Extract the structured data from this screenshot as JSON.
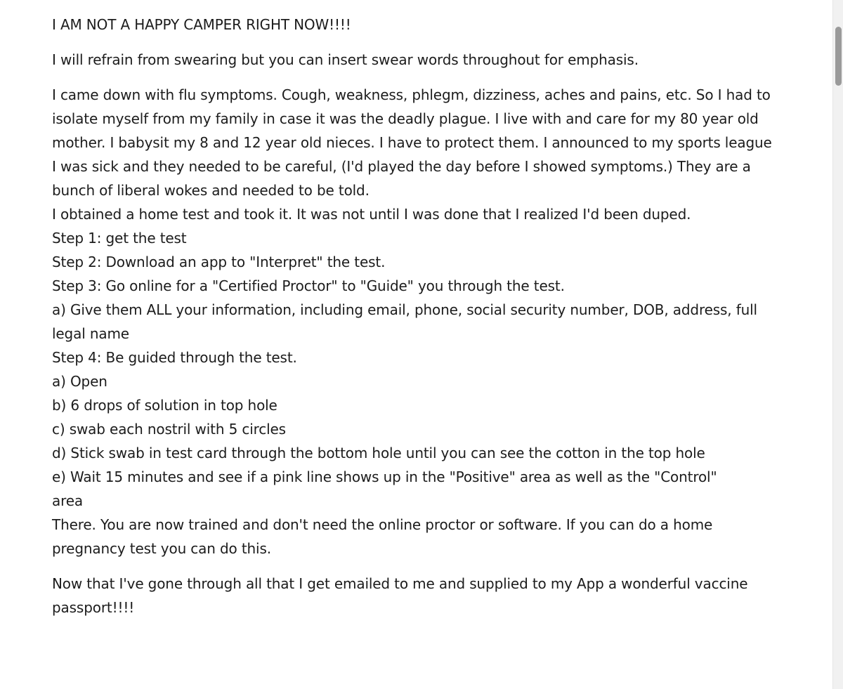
{
  "post": {
    "heading": "I AM NOT A HAPPY CAMPER RIGHT NOW!!!!",
    "para1": "I will refrain from swearing but you can insert swear words throughout for emphasis.",
    "para2_lines": [
      "I came down with flu symptoms. Cough, weakness, phlegm, dizziness, aches and pains, etc. So I had to",
      "isolate myself from my family in case it was the deadly plague. I live with and care for my 80 year old",
      "mother. I babysit my 8 and 12 year old nieces. I have to protect them. I announced to my sports league",
      "I was sick and they needed to be careful, (I'd played the day before I showed symptoms.) They are a",
      "bunch of liberal wokes and needed to be told.",
      "I obtained a home test and took it. It was not until I was done that I realized I'd been duped.",
      "Step 1: get the test",
      "Step 2: Download an app to \"Interpret\" the test.",
      "Step 3: Go online for a \"Certified Proctor\" to \"Guide\" you through the test.",
      "a) Give them ALL your information, including email, phone, social security number, DOB, address, full",
      "legal name",
      "Step 4: Be guided through the test.",
      "a) Open",
      "b) 6 drops of solution in top hole",
      "c) swab each nostril with 5 circles",
      "d) Stick swab in test card through the bottom hole until you can see the cotton in the top hole",
      "e) Wait 15 minutes and see if a pink line shows up in the \"Positive\" area as well as the \"Control\"",
      "area",
      "There. You are now trained and don't need the online proctor or software. If you can do a home",
      "pregnancy test you can do this."
    ],
    "para3_lines": [
      "Now that I've gone through all that I get emailed to me and supplied to my App a wonderful vaccine",
      "passport!!!!"
    ]
  }
}
